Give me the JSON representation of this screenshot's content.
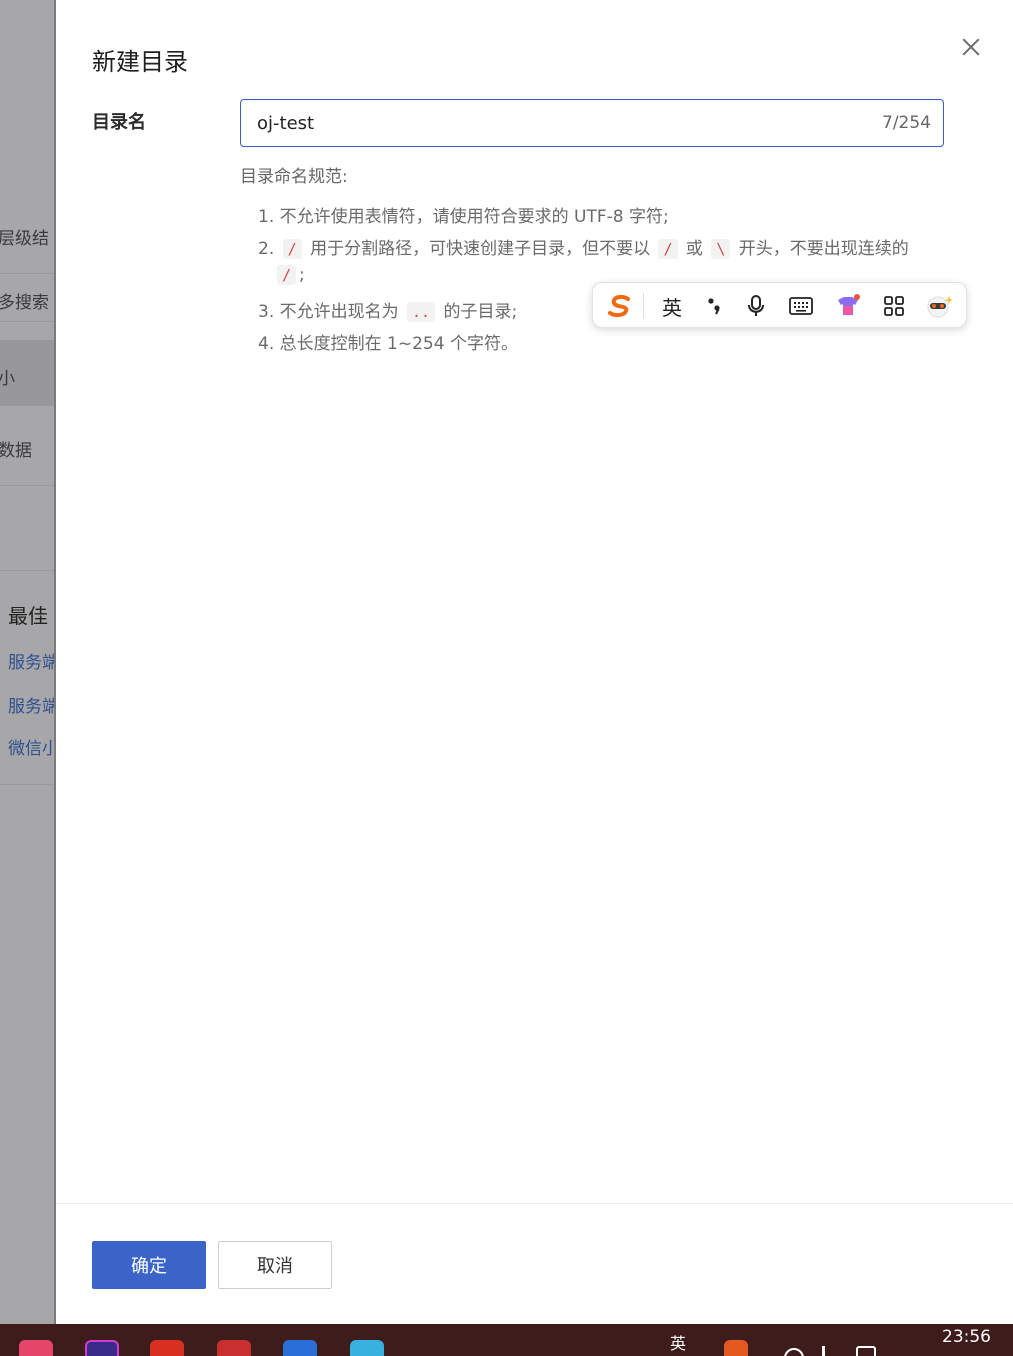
{
  "background": {
    "texts": [
      "层级结",
      "多搜索",
      "小",
      "数据",
      "最佳",
      "服务端",
      "服务端",
      "微信小"
    ]
  },
  "drawer": {
    "title": "新建目录",
    "field_label": "目录名",
    "input_value": "oj-test",
    "input_count": "7/254",
    "rules_title": "目录命名规范:",
    "rules": {
      "r1": "1. 不允许使用表情符，请使用符合要求的 UTF-8 字符;",
      "r2_prefix": "2.",
      "r2_code1": "/",
      "r2_mid": "用于分割路径，可快速创建子目录，但不要以",
      "r2_code2": "/",
      "r2_or": "或",
      "r2_code3": "\\",
      "r2_suffix": "开头，不要出现连续的",
      "r2_code4": "/",
      "r2_end": ";",
      "r3_prefix": "3. 不允许出现名为",
      "r3_code": "..",
      "r3_suffix": "的子目录;",
      "r4": "4. 总长度控制在 1~254 个字符。"
    },
    "ok_label": "确定",
    "cancel_label": "取消"
  },
  "ime": {
    "lang_label": "英"
  },
  "taskbar": {
    "lang": "英",
    "clock": "23:56"
  },
  "colors": {
    "primary": "#3a64c8",
    "code_text": "#d24a4a",
    "taskbar": "#3e1c1c"
  }
}
